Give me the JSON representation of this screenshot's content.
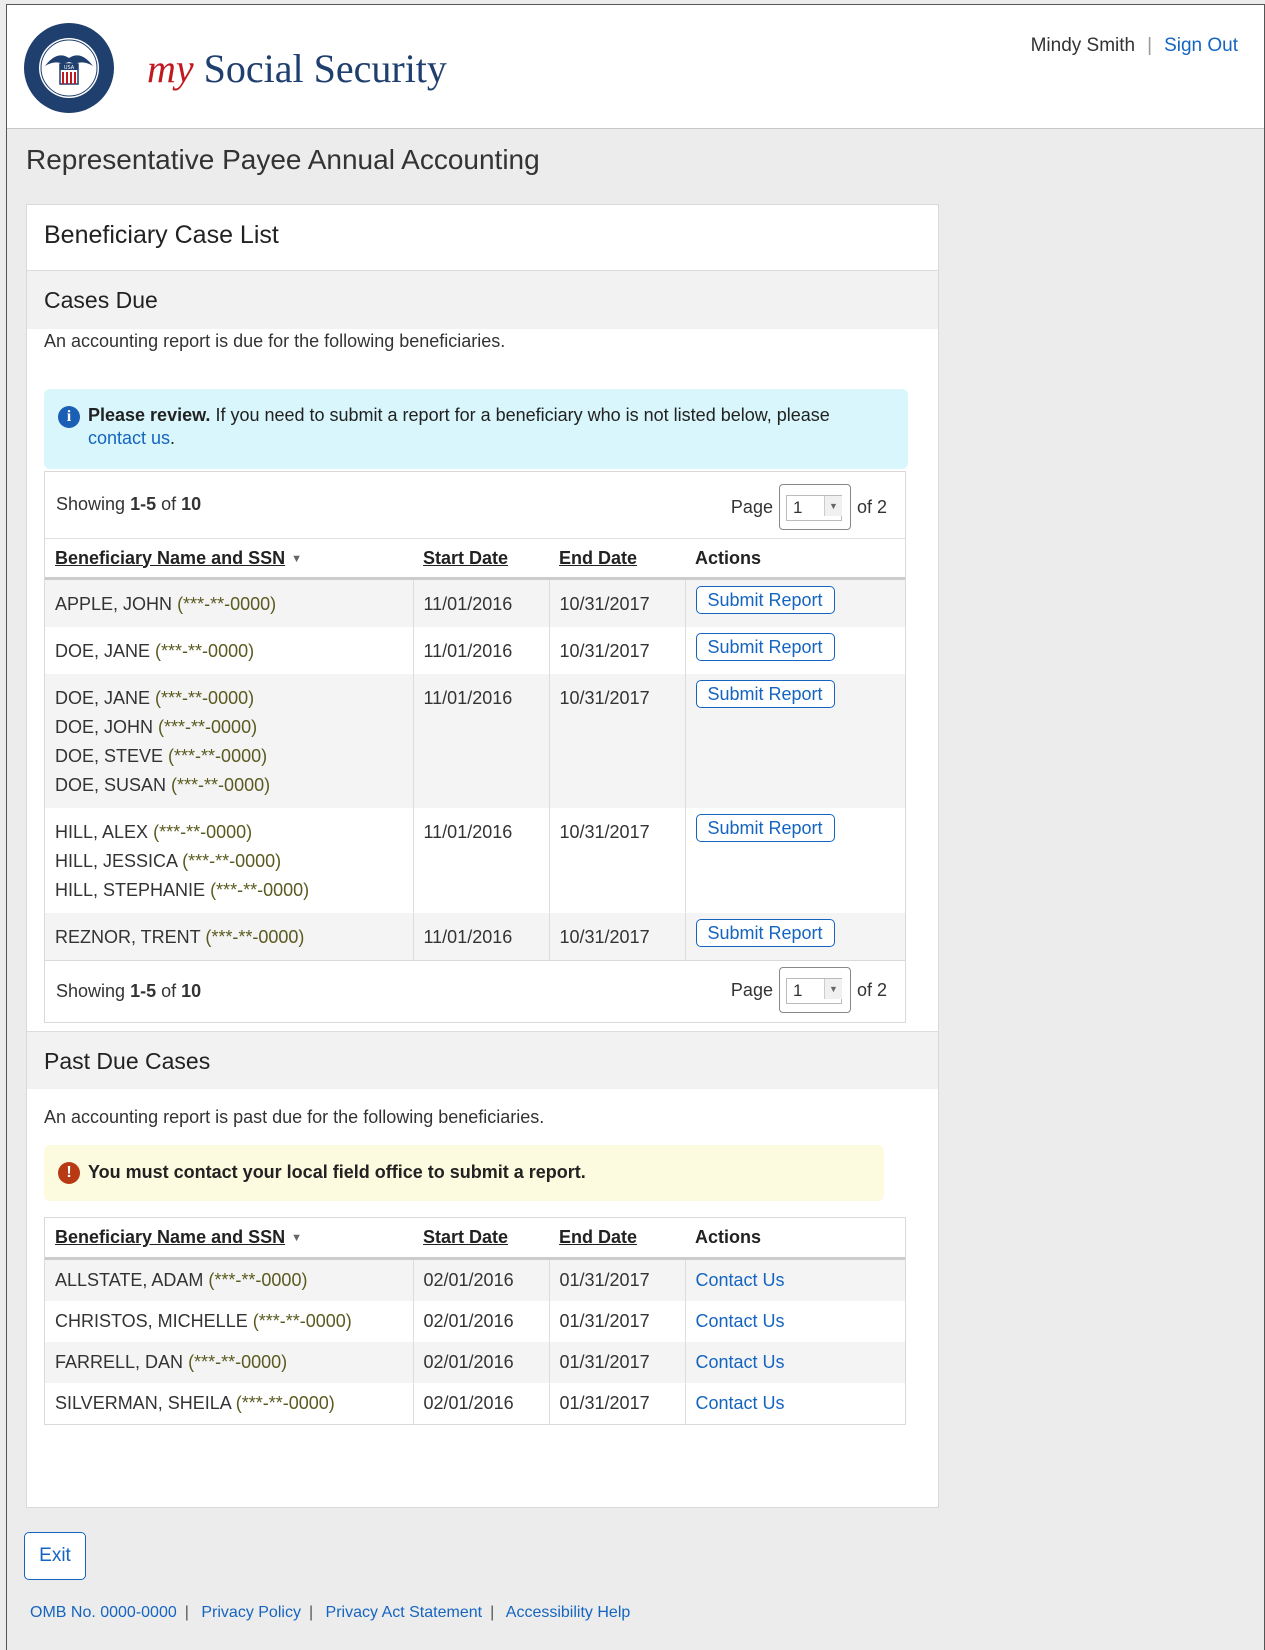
{
  "header": {
    "brand_my": "my",
    "brand_rest": "Social Security",
    "user_name": "Mindy Smith",
    "sign_out": "Sign Out",
    "seal_text": "SOCIAL SECURITY ADMINISTRATION",
    "seal_usa": "USA"
  },
  "page_title": "Representative Payee Annual Accounting",
  "case_list": {
    "title": "Beneficiary Case List",
    "due": {
      "heading": "Cases Due",
      "description": "An accounting report is due for the following beneficiaries.",
      "alert_bold": "Please review.",
      "alert_text": " If you need to submit a report for a beneficiary who is not listed below, please ",
      "alert_link": "contact us",
      "alert_end": ".",
      "showing_prefix": "Showing ",
      "showing_range": "1-5",
      "showing_of": " of ",
      "showing_total": "10",
      "page_label": "Page",
      "page_value": "1",
      "page_of": "of 2",
      "columns": [
        "Beneficiary Name and SSN",
        "Start Date",
        "End Date",
        "Actions"
      ],
      "rows": [
        {
          "names": [
            [
              "APPLE, JOHN",
              "(***-**-0000)"
            ]
          ],
          "start": "11/01/2016",
          "end": "10/31/2017",
          "action": "Submit Report"
        },
        {
          "names": [
            [
              "DOE, JANE",
              "(***-**-0000)"
            ]
          ],
          "start": "11/01/2016",
          "end": "10/31/2017",
          "action": "Submit Report"
        },
        {
          "names": [
            [
              "DOE, JANE",
              "(***-**-0000)"
            ],
            [
              "DOE, JOHN",
              "(***-**-0000)"
            ],
            [
              "DOE, STEVE",
              "(***-**-0000)"
            ],
            [
              "DOE, SUSAN",
              "(***-**-0000)"
            ]
          ],
          "start": "11/01/2016",
          "end": "10/31/2017",
          "action": "Submit Report"
        },
        {
          "names": [
            [
              "HILL, ALEX",
              "(***-**-0000)"
            ],
            [
              "HILL, JESSICA",
              "(***-**-0000)"
            ],
            [
              "HILL, STEPHANIE",
              "(***-**-0000)"
            ]
          ],
          "start": "11/01/2016",
          "end": "10/31/2017",
          "action": "Submit Report"
        },
        {
          "names": [
            [
              "REZNOR, TRENT",
              "(***-**-0000)"
            ]
          ],
          "start": "11/01/2016",
          "end": "10/31/2017",
          "action": "Submit Report"
        }
      ]
    },
    "past_due": {
      "heading": "Past Due Cases",
      "description": "An accounting report is past due for the following beneficiaries.",
      "alert_text": "You must contact your local field office to submit a report.",
      "columns": [
        "Beneficiary Name and SSN",
        "Start Date",
        "End Date",
        "Actions"
      ],
      "rows": [
        {
          "name": "ALLSTATE, ADAM",
          "ssn": "(***-**-0000)",
          "start": "02/01/2016",
          "end": "01/31/2017",
          "action": "Contact Us"
        },
        {
          "name": "CHRISTOS, MICHELLE",
          "ssn": "(***-**-0000)",
          "start": "02/01/2016",
          "end": "01/31/2017",
          "action": "Contact Us"
        },
        {
          "name": "FARRELL, DAN",
          "ssn": "(***-**-0000)",
          "start": "02/01/2016",
          "end": "01/31/2017",
          "action": "Contact Us"
        },
        {
          "name": "SILVERMAN, SHEILA",
          "ssn": "(***-**-0000)",
          "start": "02/01/2016",
          "end": "01/31/2017",
          "action": "Contact Us"
        }
      ]
    }
  },
  "exit_label": "Exit",
  "footer": {
    "omb": "OMB No. 0000-0000",
    "links": [
      "Privacy Policy",
      "Privacy Act Statement",
      "Accessibility Help"
    ]
  },
  "colors": {
    "link_blue": "#1565c0",
    "brand_red": "#c0191f",
    "brand_navy": "#1f3f6e",
    "info_bg": "#d8f6fb",
    "warn_bg": "#fcfadf"
  }
}
